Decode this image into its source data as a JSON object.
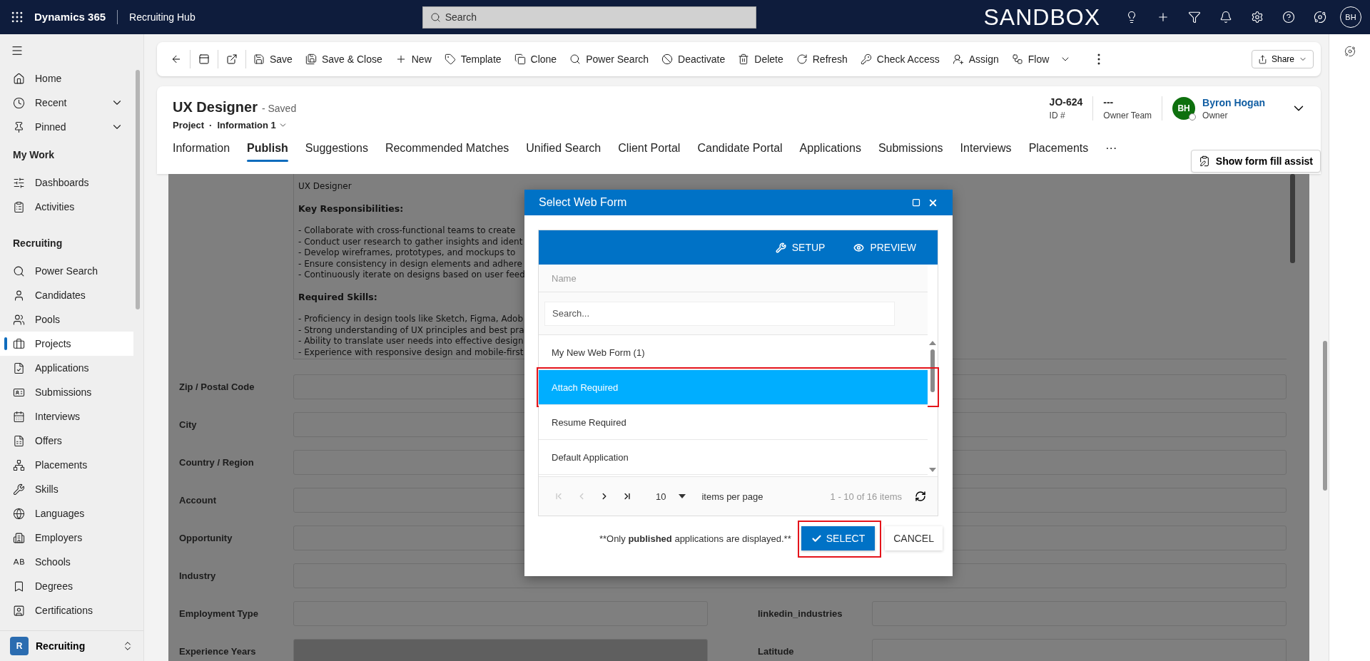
{
  "app_bar": {
    "app_name": "Dynamics 365",
    "area": "Recruiting Hub",
    "search_placeholder": "Search",
    "environment": "SANDBOX",
    "user_initials": "BH"
  },
  "sidebar": {
    "items": [
      {
        "kind": "item",
        "label": "Home",
        "selected": false,
        "expandable": false
      },
      {
        "kind": "item",
        "label": "Recent",
        "selected": false,
        "expandable": true
      },
      {
        "kind": "item",
        "label": "Pinned",
        "selected": false,
        "expandable": true
      },
      {
        "kind": "section",
        "label": "My Work"
      },
      {
        "kind": "item",
        "label": "Dashboards",
        "selected": false,
        "expandable": false
      },
      {
        "kind": "item",
        "label": "Activities",
        "selected": false,
        "expandable": false
      },
      {
        "kind": "section",
        "label": "Recruiting"
      },
      {
        "kind": "item",
        "label": "Power Search",
        "selected": false,
        "expandable": false
      },
      {
        "kind": "item",
        "label": "Candidates",
        "selected": false,
        "expandable": false
      },
      {
        "kind": "item",
        "label": "Pools",
        "selected": false,
        "expandable": false
      },
      {
        "kind": "item",
        "label": "Projects",
        "selected": true,
        "expandable": false
      },
      {
        "kind": "item",
        "label": "Applications",
        "selected": false,
        "expandable": false
      },
      {
        "kind": "item",
        "label": "Submissions",
        "selected": false,
        "expandable": false
      },
      {
        "kind": "item",
        "label": "Interviews",
        "selected": false,
        "expandable": false
      },
      {
        "kind": "item",
        "label": "Offers",
        "selected": false,
        "expandable": false
      },
      {
        "kind": "item",
        "label": "Placements",
        "selected": false,
        "expandable": false
      },
      {
        "kind": "item",
        "label": "Skills",
        "selected": false,
        "expandable": false
      },
      {
        "kind": "item",
        "label": "Languages",
        "selected": false,
        "expandable": false
      },
      {
        "kind": "item",
        "label": "Employers",
        "selected": false,
        "expandable": false
      },
      {
        "kind": "item",
        "label": "Schools",
        "selected": false,
        "expandable": false
      },
      {
        "kind": "item",
        "label": "Degrees",
        "selected": false,
        "expandable": false
      },
      {
        "kind": "item",
        "label": "Certifications",
        "selected": false,
        "expandable": false
      }
    ],
    "area_switcher": {
      "initial": "R",
      "label": "Recruiting"
    }
  },
  "command_bar": {
    "commands": [
      {
        "label": "Save",
        "menu": false
      },
      {
        "label": "Save & Close",
        "menu": false
      },
      {
        "label": "New",
        "menu": false
      },
      {
        "label": "Template",
        "menu": false
      },
      {
        "label": "Clone",
        "menu": false
      },
      {
        "label": "Power Search",
        "menu": false
      },
      {
        "label": "Deactivate",
        "menu": false
      },
      {
        "label": "Delete",
        "menu": false
      },
      {
        "label": "Refresh",
        "menu": false
      },
      {
        "label": "Check Access",
        "menu": false
      },
      {
        "label": "Assign",
        "menu": false
      },
      {
        "label": "Flow",
        "menu": true
      }
    ],
    "share": "Share"
  },
  "header": {
    "title": "UX Designer",
    "status": "- Saved",
    "entity": "Project",
    "separator": "·",
    "form_name": "Information 1",
    "fields": [
      {
        "value": "JO-624",
        "label": "ID #"
      },
      {
        "value": "---",
        "label": "Owner Team"
      }
    ],
    "owner": {
      "initials": "BH",
      "name": "Byron Hogan",
      "label": "Owner"
    },
    "tabs": [
      {
        "label": "Information",
        "selected": false
      },
      {
        "label": "Publish",
        "selected": true
      },
      {
        "label": "Suggestions",
        "selected": false
      },
      {
        "label": "Recommended Matches",
        "selected": false
      },
      {
        "label": "Unified Search",
        "selected": false
      },
      {
        "label": "Client Portal",
        "selected": false
      },
      {
        "label": "Candidate Portal",
        "selected": false
      },
      {
        "label": "Applications",
        "selected": false
      },
      {
        "label": "Submissions",
        "selected": false
      },
      {
        "label": "Interviews",
        "selected": false
      },
      {
        "label": "Placements",
        "selected": false
      }
    ],
    "more_tabs": "···",
    "assist_button": "Show form fill assist"
  },
  "form": {
    "description": [
      {
        "kind": "text",
        "text": "UX Designer"
      },
      {
        "kind": "heading",
        "text": "Key Responsibilities:"
      },
      {
        "kind": "text",
        "text": "- Collaborate with cross-functional teams to create"
      },
      {
        "kind": "text",
        "text": "- Conduct user research to gather insights and ident"
      },
      {
        "kind": "text",
        "text": "- Develop wireframes, prototypes, and mockups to"
      },
      {
        "kind": "text",
        "text": "- Ensure consistency in design elements and adhere"
      },
      {
        "kind": "text",
        "text": "- Continuously iterate on designs based on user feed"
      },
      {
        "kind": "heading",
        "text": "Required Skills:"
      },
      {
        "kind": "text",
        "text": "- Proficiency in design tools like Sketch, Figma, Adob"
      },
      {
        "kind": "text",
        "text": "- Strong understanding of UX principles and best pra"
      },
      {
        "kind": "text",
        "text": "- Ability to translate user needs into effective design"
      },
      {
        "kind": "text",
        "text": "- Experience with responsive design and mobile-first"
      }
    ],
    "rows": [
      {
        "fields": [
          {
            "label": "Zip / Postal Code",
            "disabled": false
          }
        ]
      },
      {
        "fields": [
          {
            "label": "City",
            "disabled": false
          }
        ]
      },
      {
        "fields": [
          {
            "label": "Country / Region",
            "disabled": false
          }
        ]
      },
      {
        "fields": [
          {
            "label": "Account",
            "disabled": false
          }
        ]
      },
      {
        "fields": [
          {
            "label": "Opportunity",
            "disabled": false
          }
        ]
      },
      {
        "fields": [
          {
            "label": "Industry",
            "disabled": false
          }
        ]
      },
      {
        "fields": [
          {
            "label": "Employment Type",
            "disabled": false
          },
          {
            "label": "linkedin_industries",
            "disabled": false
          }
        ]
      },
      {
        "fields": [
          {
            "label": "Experience Years",
            "disabled": true
          },
          {
            "label": "Latitude",
            "disabled": false
          }
        ]
      }
    ]
  },
  "dialog": {
    "title": "Select Web Form",
    "toolbar": [
      {
        "kind": "setup",
        "label": "SETUP"
      },
      {
        "kind": "preview",
        "label": "PREVIEW"
      }
    ],
    "column": "Name",
    "search_placeholder": "Search...",
    "items": [
      {
        "label": "My New Web Form (1)",
        "selected": false
      },
      {
        "label": "Attach Required",
        "selected": true
      },
      {
        "label": "Resume Required",
        "selected": false
      },
      {
        "label": "Default Application",
        "selected": false
      }
    ],
    "pager": {
      "nav": [
        {
          "kind": "first",
          "disabled": true
        },
        {
          "kind": "prev",
          "disabled": true
        },
        {
          "kind": "next",
          "disabled": false
        },
        {
          "kind": "last",
          "disabled": false
        }
      ],
      "page_size": "10",
      "page_size_label": "items per page",
      "summary": "1 - 10 of 16 items"
    },
    "note": {
      "before": "**Only",
      "emphasis": "published",
      "after": "applications are displayed.**"
    },
    "select": {
      "label": "SELECT",
      "highlighted": true
    },
    "cancel": "CANCEL"
  }
}
